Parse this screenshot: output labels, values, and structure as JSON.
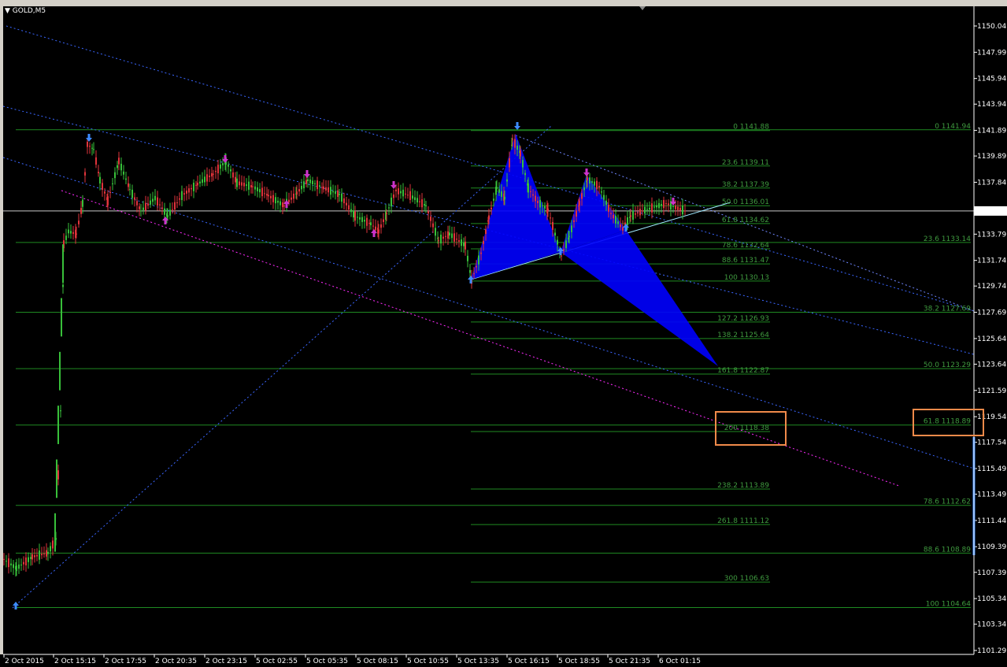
{
  "window": {
    "symbol_label": "GOLD,M5"
  },
  "colors": {
    "background": "#000000",
    "bull_candle": "#38c03a",
    "bear_candle": "#e0343b",
    "fib_line": "#1f8a22",
    "fib_text": "#3f9a3f",
    "channel": "#3a66ff",
    "magenta_line": "#ff2bff",
    "pattern_fill": "#0000ff",
    "highlight_box": "#f08a4a",
    "current_price_line": "#c8c8c8"
  },
  "chart_data": {
    "type": "candlestick",
    "symbol": "GOLD",
    "timeframe": "M5",
    "current_price": "1135.60",
    "ylim": [
      1101.29,
      1151.0
    ],
    "y_ticks": [
      "1150.04",
      "1147.99",
      "1145.94",
      "1143.94",
      "1141.89",
      "1139.89",
      "1137.84",
      "1135.60",
      "1133.79",
      "1131.74",
      "1129.74",
      "1127.69",
      "1125.64",
      "1123.64",
      "1121.59",
      "1119.54",
      "1117.54",
      "1115.49",
      "1113.49",
      "1111.44",
      "1109.39",
      "1107.39",
      "1105.34",
      "1103.34",
      "1101.29"
    ],
    "x_ticks": [
      "2 Oct 2015",
      "2 Oct 15:15",
      "2 Oct 17:55",
      "2 Oct 20:35",
      "2 Oct 23:15",
      "5 Oct 02:55",
      "5 Oct 05:35",
      "5 Oct 08:15",
      "5 Oct 10:55",
      "5 Oct 13:35",
      "5 Oct 16:15",
      "5 Oct 18:55",
      "5 Oct 21:35",
      "6 Oct 01:15"
    ],
    "fib_levels_left": [
      {
        "label": "0 1141.88",
        "price": 1141.88
      },
      {
        "label": "23.6 1139.11",
        "price": 1139.11
      },
      {
        "label": "38.2 1137.39",
        "price": 1137.39
      },
      {
        "label": "50.0 1136.01",
        "price": 1136.01
      },
      {
        "label": "61.8 1134.62",
        "price": 1134.62
      },
      {
        "label": "78.6 1132.64",
        "price": 1132.64
      },
      {
        "label": "88.6 1131.47",
        "price": 1131.47
      },
      {
        "label": "100 1130.13",
        "price": 1130.13
      },
      {
        "label": "127.2 1126.93",
        "price": 1126.93
      },
      {
        "label": "138.2 1125.64",
        "price": 1125.64
      },
      {
        "label": "161.8 1122.87",
        "price": 1122.87
      },
      {
        "label": "200 1118.38",
        "price": 1118.38
      },
      {
        "label": "238.2 1113.89",
        "price": 1113.89
      },
      {
        "label": "261.8 1111.12",
        "price": 1111.12
      },
      {
        "label": "300 1106.63",
        "price": 1106.63
      }
    ],
    "fib_levels_right": [
      {
        "label": "0 1141.94",
        "price": 1141.94
      },
      {
        "label": "23.6 1133.14",
        "price": 1133.14
      },
      {
        "label": "38.2 1127.69",
        "price": 1127.69
      },
      {
        "label": "50.0 1123.29",
        "price": 1123.29
      },
      {
        "label": "61.8 1118.89",
        "price": 1118.89
      },
      {
        "label": "78.6 1112.62",
        "price": 1112.62
      },
      {
        "label": "88.6 1108.89",
        "price": 1108.89
      },
      {
        "label": "100 1104.64",
        "price": 1104.64
      }
    ]
  }
}
